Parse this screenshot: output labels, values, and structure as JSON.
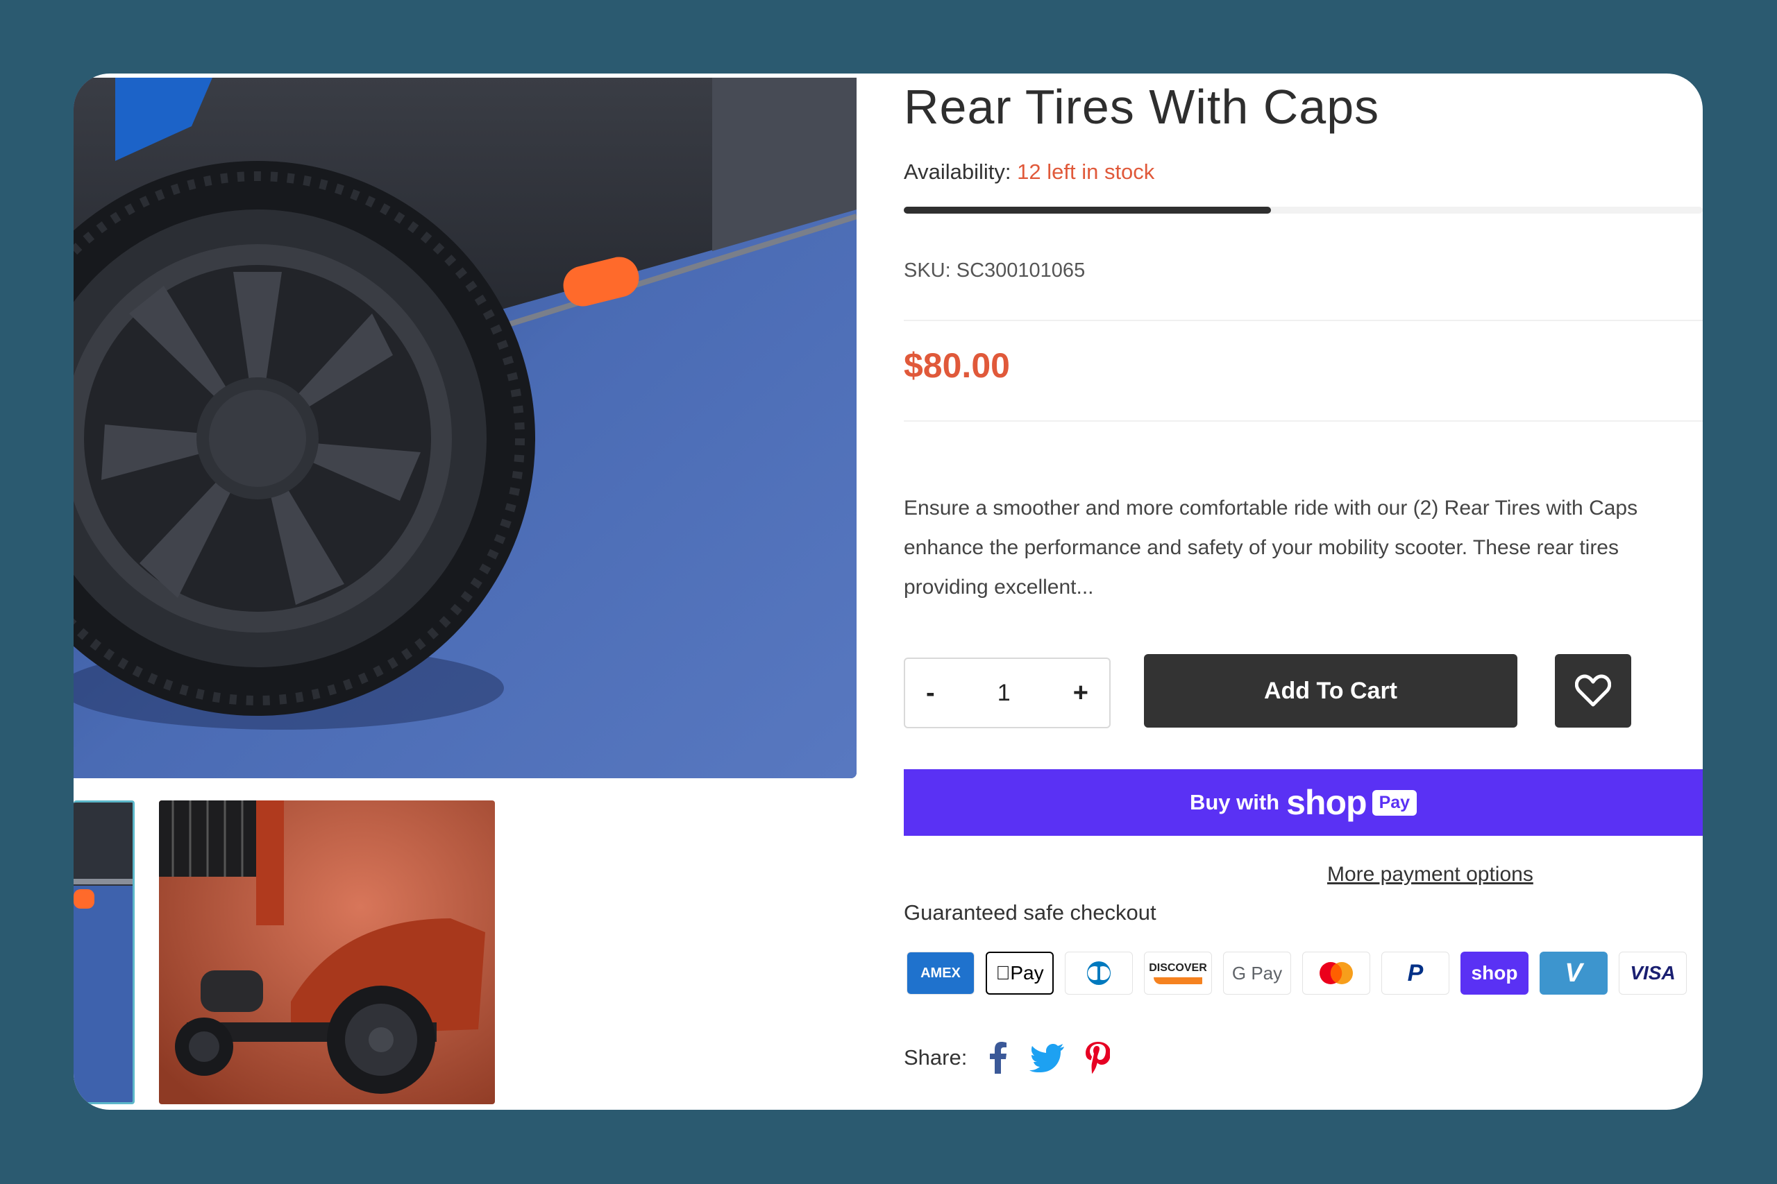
{
  "product": {
    "title": "Rear Tires With Caps",
    "availability_label": "Availability:",
    "availability_value": "12 left in stock",
    "stock_fraction": 0.46,
    "sku_label": "SKU:",
    "sku_value": "SC300101065",
    "price": "$80.00",
    "description_lines": [
      "Ensure a smoother and more comfortable ride with our (2) Rear Tires with Caps",
      "enhance the performance and safety of your mobility scooter. These rear tires",
      "providing excellent..."
    ]
  },
  "cart": {
    "minus": "-",
    "quantity": "1",
    "plus": "+",
    "add_to_cart": "Add To Cart"
  },
  "checkout": {
    "buy_with": "Buy with",
    "shop_word": "shop",
    "pay_word": "Pay",
    "more_options": "More payment options",
    "guarantee": "Guaranteed safe checkout",
    "methods": [
      {
        "label": "AMEX",
        "icon": "amex-icon",
        "bg": "#1f72cd",
        "fg": "#ffffff"
      },
      {
        "label": "Pay",
        "icon": "apple-pay-icon",
        "bg": "#ffffff",
        "fg": "#000000"
      },
      {
        "label": "D",
        "icon": "diners-club-icon",
        "bg": "#ffffff",
        "fg": "#0079be"
      },
      {
        "label": "DISCOVER",
        "icon": "discover-icon",
        "bg": "#ffffff",
        "fg": "#222222"
      },
      {
        "label": "G Pay",
        "icon": "google-pay-icon",
        "bg": "#ffffff",
        "fg": "#5f6368"
      },
      {
        "label": "",
        "icon": "mastercard-icon",
        "bg": "#ffffff",
        "fg": "#eb001b"
      },
      {
        "label": "P",
        "icon": "paypal-icon",
        "bg": "#ffffff",
        "fg": "#003087"
      },
      {
        "label": "shop",
        "icon": "shop-pay-icon",
        "bg": "#5a31f4",
        "fg": "#ffffff"
      },
      {
        "label": "V",
        "icon": "venmo-icon",
        "bg": "#3d95ce",
        "fg": "#ffffff"
      },
      {
        "label": "VISA",
        "icon": "visa-icon",
        "bg": "#ffffff",
        "fg": "#1a1f71"
      }
    ]
  },
  "share": {
    "label": "Share:",
    "networks": [
      "facebook-icon",
      "twitter-icon",
      "pinterest-icon"
    ]
  },
  "colors": {
    "page_bg": "#2b5a70",
    "accent": "#e0593a",
    "shop_pay": "#5a31f4",
    "button_dark": "#333333"
  }
}
